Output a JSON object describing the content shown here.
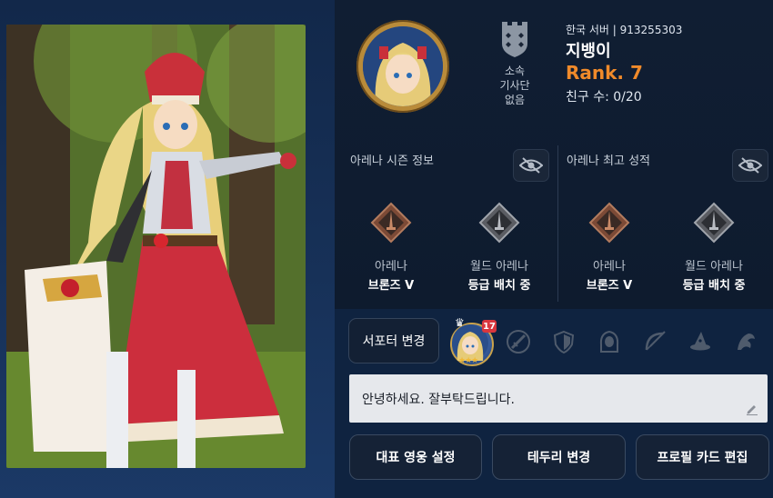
{
  "profile": {
    "server_label": "한국 서버 | 913255303",
    "nickname": "지뱅이",
    "rank": "Rank. 7",
    "friends": "친구 수: 0/20",
    "guild_status": [
      "소속",
      "기사단",
      "없음"
    ]
  },
  "arena_season": {
    "title": "아레나 시즌 정보",
    "entries": [
      {
        "label": "아레나",
        "value": "브론즈 V",
        "icon": "arena-bronze-emblem"
      },
      {
        "label": "월드 아레나",
        "value": "등급 배치 중",
        "icon": "world-arena-emblem"
      }
    ]
  },
  "arena_best": {
    "title": "아레나 최고 성적",
    "entries": [
      {
        "label": "아레나",
        "value": "브론즈 V",
        "icon": "arena-bronze-emblem"
      },
      {
        "label": "월드 아레나",
        "value": "등급 배치 중",
        "icon": "world-arena-emblem"
      }
    ]
  },
  "supporter": {
    "button_label": "서포터 변경",
    "hero_level": "17",
    "hero_stars": 3,
    "class_icons": [
      "sword-icon",
      "shield-icon",
      "hooded-figure-icon",
      "bow-icon",
      "wizard-hat-icon",
      "dragon-icon"
    ]
  },
  "greeting": "안녕하세요. 잘부탁드립니다.",
  "buttons": {
    "set_hero": "대표 영웅 설정",
    "change_frame": "테두리 변경",
    "edit_card": "프로필 카드 편집"
  },
  "colors": {
    "rank": "#f08a2a",
    "background": "#0e1b2f",
    "level_badge": "#d9363e"
  }
}
